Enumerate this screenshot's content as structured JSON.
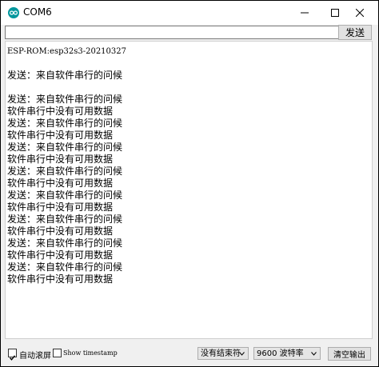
{
  "window": {
    "title": "COM6",
    "minimize_icon": "minimize-icon",
    "maximize_icon": "maximize-icon",
    "close_icon": "close-icon",
    "app_icon": "arduino-icon",
    "app_icon_color": "#00979d"
  },
  "toolbar": {
    "send_input_value": "",
    "send_label": "发送"
  },
  "serial_output": {
    "lines": [
      "ESP-ROM:esp32s3-20210327",
      "",
      "发送：来自软件串行的问候",
      "",
      "发送：来自软件串行的问候",
      "软件串行中没有可用数据",
      "发送：来自软件串行的问候",
      "软件串行中没有可用数据",
      "发送：来自软件串行的问候",
      "软件串行中没有可用数据",
      "发送：来自软件串行的问候",
      "软件串行中没有可用数据",
      "发送：来自软件串行的问候",
      "软件串行中没有可用数据",
      "发送：来自软件串行的问候",
      "软件串行中没有可用数据",
      "发送：来自软件串行的问候",
      "软件串行中没有可用数据",
      "发送：来自软件串行的问候",
      "软件串行中没有可用数据"
    ]
  },
  "statusbar": {
    "autoscroll_label": "自动滚屏",
    "autoscroll_checked": true,
    "timestamp_label": "Show timestamp",
    "timestamp_checked": false,
    "line_ending_selected": "没有结束符",
    "baud_selected": "9600 波特率",
    "clear_label": "清空输出"
  }
}
